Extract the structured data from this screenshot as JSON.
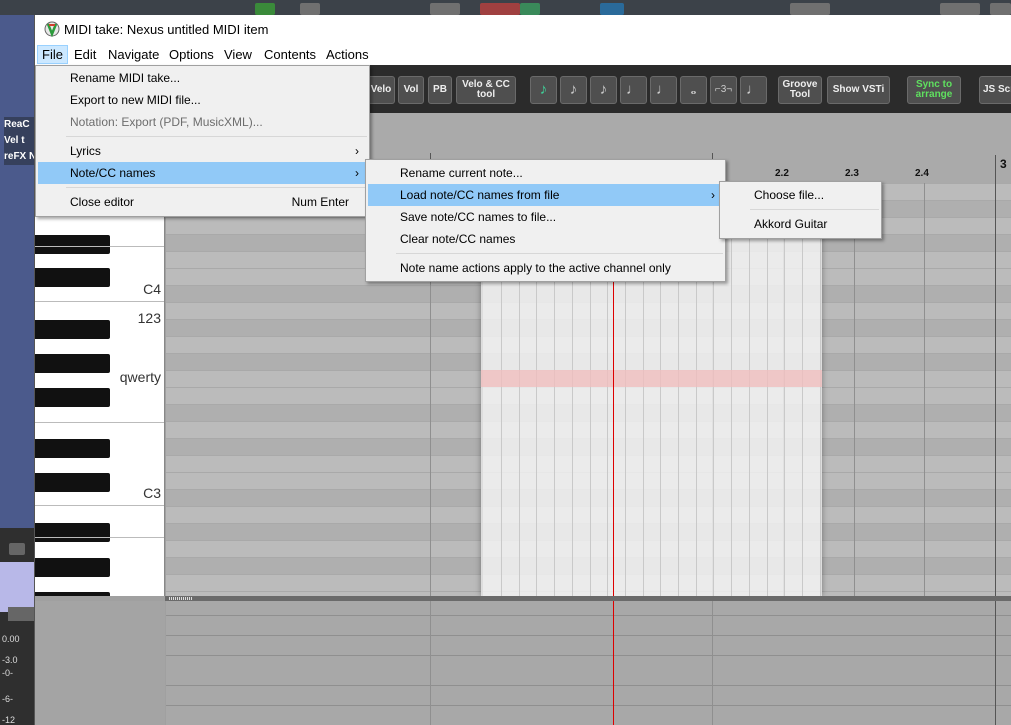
{
  "window": {
    "title": "MIDI take: Nexus untitled MIDI item"
  },
  "menubar": [
    "File",
    "Edit",
    "Navigate",
    "Options",
    "View",
    "Contents",
    "Actions"
  ],
  "file_menu": {
    "items": [
      {
        "label": "Rename MIDI take..."
      },
      {
        "label": "Export to new MIDI file..."
      },
      {
        "label": "Notation: Export (PDF, MusicXML)..."
      },
      {
        "label": "Lyrics"
      },
      {
        "label": "Note/CC names"
      },
      {
        "label": "Close editor",
        "accel": "Num Enter"
      }
    ]
  },
  "notecc_menu": {
    "items": [
      {
        "label": "Rename current note..."
      },
      {
        "label": "Load note/CC names from file"
      },
      {
        "label": "Save note/CC names to file..."
      },
      {
        "label": "Clear note/CC names"
      },
      {
        "label": "Note name actions apply to the active channel only"
      }
    ]
  },
  "load_menu": {
    "items": [
      {
        "label": "Choose file..."
      },
      {
        "label": "Akkord Guitar"
      }
    ]
  },
  "toolbar": {
    "velo": "Velo",
    "vol": "Vol",
    "pb": "PB",
    "velo_cc_1": "Velo & CC",
    "velo_cc_2": "tool",
    "groove_1": "Groove",
    "groove_2": "Tool",
    "show_vsti": "Show VSTi",
    "sync_1": "Sync to",
    "sync_2": "arrange",
    "js": "JS Scr",
    "triplet": "⌐3¬"
  },
  "ruler": {
    "labels": [
      "2.2",
      "2.3",
      "2.4",
      "3"
    ]
  },
  "keyboard": {
    "labels": [
      "C4",
      "123",
      "qwerty",
      "C3"
    ]
  },
  "background": {
    "left_labels": [
      "ReaC",
      "Vel t",
      "reFX N"
    ],
    "level_values": [
      "0.00",
      "-3.0",
      "-0-",
      "-6-",
      "-12"
    ]
  }
}
